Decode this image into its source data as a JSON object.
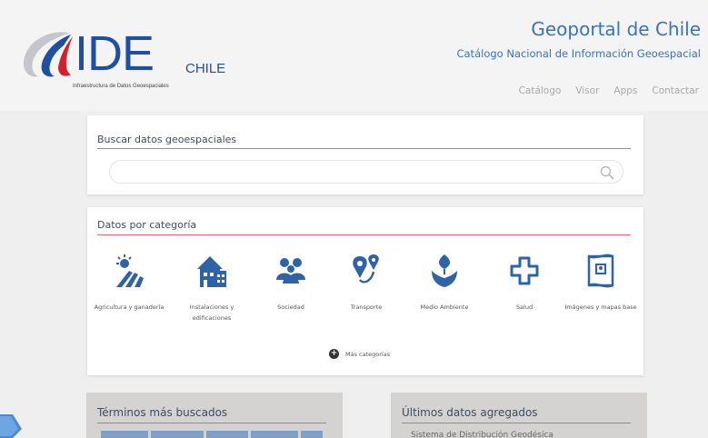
{
  "header": {
    "logo_text": "IDE",
    "logo_country": "CHILE",
    "logo_subtitle": "Infraestructura de Datos Geoespaciales",
    "site_title": "Geoportal de Chile",
    "site_subtitle": "Catálogo Nacional de Información Geoespacial",
    "nav": [
      "Catálogo",
      "Visor",
      "Apps",
      "Contactar"
    ]
  },
  "search": {
    "title": "Buscar datos geoespaciales",
    "placeholder": ""
  },
  "categories": {
    "title": "Datos por categoría",
    "items": [
      {
        "label": "Agricultura y ganadería",
        "icon": "agriculture-icon"
      },
      {
        "label": "Instalaciones y edificaciones",
        "icon": "building-icon"
      },
      {
        "label": "Sociedad",
        "icon": "people-icon"
      },
      {
        "label": "Transporte",
        "icon": "transport-icon"
      },
      {
        "label": "Medio Ambiente",
        "icon": "environment-icon"
      },
      {
        "label": "Salud",
        "icon": "health-icon"
      },
      {
        "label": "Imágenes y mapas base",
        "icon": "map-icon"
      }
    ],
    "more_label": "Más categorías"
  },
  "most_searched": {
    "title": "Términos más buscados"
  },
  "latest": {
    "title": "Últimos datos agregados",
    "first_item": "Sistema de Distribución Geodésica"
  },
  "colors": {
    "brand_blue": "#1f4fa0",
    "title_blue": "#3a73b7",
    "rule_red": "#d96b74",
    "icon_blue": "#2f63a8"
  }
}
